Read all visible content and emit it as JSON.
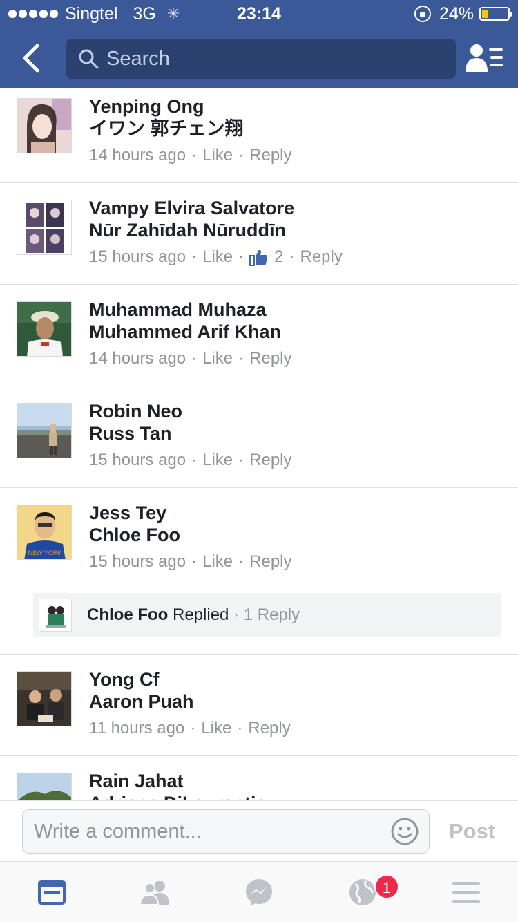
{
  "status_bar": {
    "carrier": "Singtel",
    "network": "3G",
    "time": "23:14",
    "battery_text": "24%",
    "battery_level": 0.24,
    "battery_color": "#f7c800"
  },
  "nav": {
    "back_icon": "chevron-left-icon",
    "search_placeholder": "Search",
    "profile_icon": "person-list-icon"
  },
  "colors": {
    "brand": "#3b5998",
    "meta_gray": "#90949c",
    "badge_red": "#f02849",
    "tab_active": "#4267b2"
  },
  "comments": [
    {
      "name": "Yenping Ong",
      "text": "イワン 郭チェン翔",
      "time": "14 hours ago",
      "like": "Like",
      "reply": "Reply"
    },
    {
      "name": "Vampy Elvira Salvatore",
      "text": "Nūr Zahīdah Nūruddīn",
      "time": "15 hours ago",
      "like": "Like",
      "reactions": "2",
      "reply": "Reply"
    },
    {
      "name": "Muhammad Muhaza",
      "text": "Muhammed Arif Khan",
      "time": "14 hours ago",
      "like": "Like",
      "reply": "Reply"
    },
    {
      "name": "Robin Neo",
      "text": "Russ Tan",
      "time": "15 hours ago",
      "like": "Like",
      "reply": "Reply"
    },
    {
      "name": "Jess Tey",
      "text": "Chloe Foo",
      "time": "15 hours ago",
      "like": "Like",
      "reply": "Reply",
      "replied": {
        "name": "Chloe Foo",
        "label": "Replied",
        "count": "1 Reply"
      }
    },
    {
      "name": "Yong Cf",
      "text": "Aaron Puah",
      "time": "11 hours ago",
      "like": "Like",
      "reply": "Reply"
    },
    {
      "name": "Rain Jahat",
      "text": "Adriana DiLaurentis",
      "time": "",
      "like": "",
      "reply": ""
    }
  ],
  "composer": {
    "placeholder": "Write a comment...",
    "emoji_icon": "smiley-icon",
    "post_label": "Post"
  },
  "tabs": [
    {
      "icon": "news-feed-icon",
      "active": true
    },
    {
      "icon": "friends-icon",
      "active": false
    },
    {
      "icon": "messenger-icon",
      "active": false
    },
    {
      "icon": "globe-notifications-icon",
      "active": false,
      "badge": "1"
    },
    {
      "icon": "menu-icon",
      "active": false
    }
  ]
}
